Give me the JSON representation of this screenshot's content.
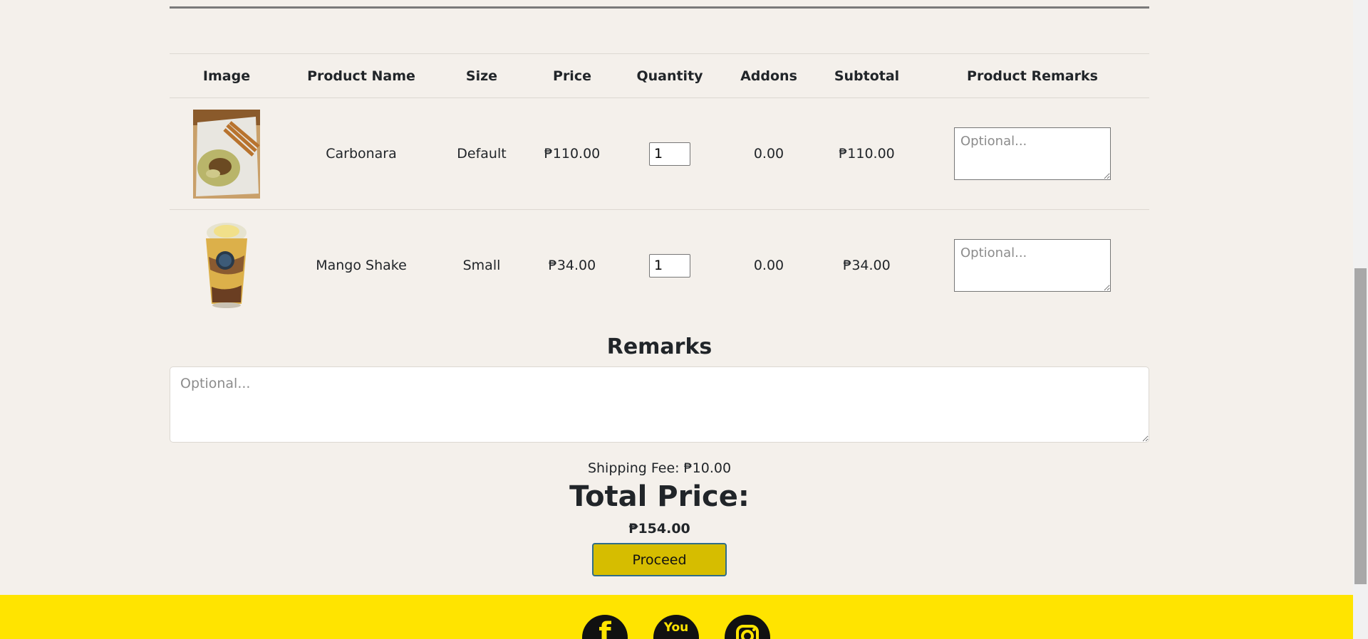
{
  "table": {
    "headers": [
      "Image",
      "Product Name",
      "Size",
      "Price",
      "Quantity",
      "Addons",
      "Subtotal",
      "Product Remarks"
    ],
    "rows": [
      {
        "name": "Carbonara",
        "size": "Default",
        "price": "₱110.00",
        "quantity": "1",
        "addons": "0.00",
        "subtotal": "₱110.00",
        "remarks_placeholder": "Optional..."
      },
      {
        "name": "Mango Shake",
        "size": "Small",
        "price": "₱34.00",
        "quantity": "1",
        "addons": "0.00",
        "subtotal": "₱34.00",
        "remarks_placeholder": "Optional..."
      }
    ]
  },
  "remarks": {
    "title": "Remarks",
    "placeholder": "Optional..."
  },
  "summary": {
    "shipping": "Shipping Fee: ₱10.00",
    "total_label": "Total Price:",
    "total_value": "₱154.00",
    "proceed_label": "Proceed"
  },
  "footer": {
    "socials": [
      {
        "name": "facebook-icon",
        "glyph": "f"
      },
      {
        "name": "youtube-icon",
        "glyph": "You"
      },
      {
        "name": "instagram-icon",
        "glyph": "◎"
      }
    ]
  },
  "colors": {
    "background": "#f4f0eb",
    "footer": "#ffe400",
    "button": "#d6bd00"
  }
}
